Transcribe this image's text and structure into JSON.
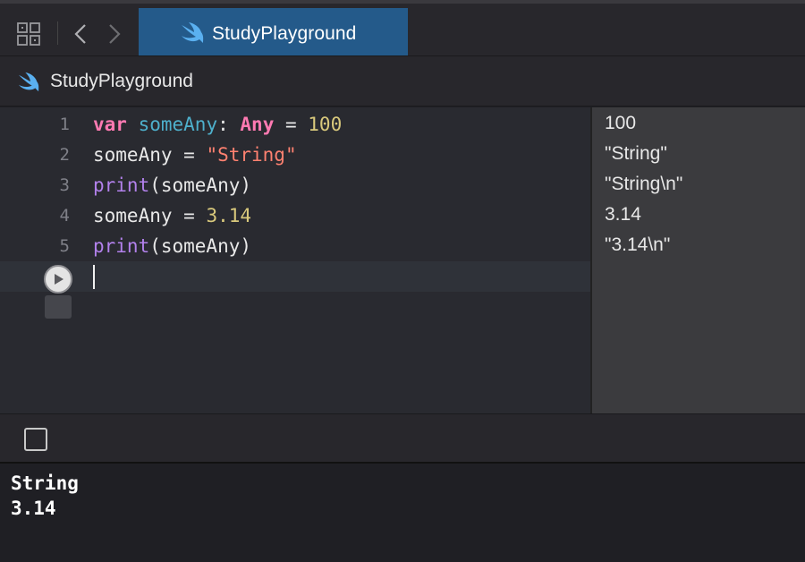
{
  "tabbar": {
    "tab_title": "StudyPlayground",
    "icons": {
      "grid": "grid-icon",
      "back": "chevron-left-icon",
      "forward": "chevron-right-icon",
      "file": "swift-icon"
    }
  },
  "jumpbar": {
    "crumb": "StudyPlayground"
  },
  "editor": {
    "line_numbers": [
      "1",
      "2",
      "3",
      "4",
      "5"
    ],
    "lines": [
      {
        "kw": "var",
        "name": "someAny",
        "colon": ": ",
        "type": "Any",
        "eq": " = ",
        "value": "100"
      },
      {
        "name": "someAny",
        "eq": " = ",
        "value": "\"String\""
      },
      {
        "fn": "print",
        "args": "(someAny)"
      },
      {
        "name": "someAny",
        "eq": " = ",
        "value": "3.14"
      },
      {
        "fn": "print",
        "args": "(someAny)"
      }
    ]
  },
  "results": [
    "100",
    "\"String\"",
    "\"String\\n\"",
    "3.14",
    "\"3.14\\n\""
  ],
  "console": {
    "lines": [
      "String",
      "3.14"
    ]
  },
  "colors": {
    "keyword": "#ff7ab2",
    "declaration": "#4eb0cc",
    "number": "#d9c97c",
    "string": "#ff8170",
    "function": "#b281eb",
    "tab_active": "#245a8a"
  }
}
